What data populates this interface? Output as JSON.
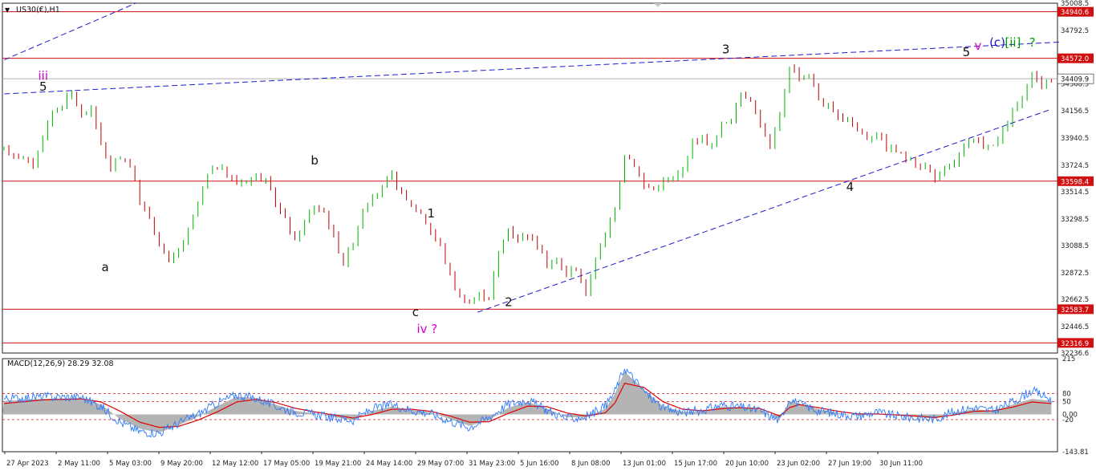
{
  "symbol_header": {
    "arrow": "▼",
    "label": "US30(€),H1"
  },
  "macd_header": "MACD(12,26,9) 28.29 32.08",
  "colors": {
    "bull": "#00b400",
    "bear": "#c00000",
    "hline": "#d01010",
    "trend": "#1c1ccc",
    "label_black": "#111111",
    "label_magenta": "#d400d4",
    "label_blue": "#1c1ccc",
    "label_green": "#00a000",
    "hist": "#b4b4b4",
    "signal": "#e00000",
    "macd_line": "#2a7aff",
    "price_line": "#b0b0b0",
    "axis_text": "#222222"
  },
  "chart_data": [
    {
      "type": "candlestick",
      "title": "US30(€),H1",
      "ylim": [
        32236.6,
        35008.5
      ],
      "y_tick_labels": [
        "35008.5",
        "34792.5",
        "34570.5",
        "34368.5",
        "34156.5",
        "33940.5",
        "33724.5",
        "33514.5",
        "33298.5",
        "33088.5",
        "32872.5",
        "32662.5",
        "32446.5",
        "32236.6"
      ],
      "x_tick_labels": [
        "27 Apr 2023",
        "2 May 11:00",
        "5 May 03:00",
        "9 May 20:00",
        "12 May 12:00",
        "17 May 05:00",
        "19 May 21:00",
        "24 May 14:00",
        "29 May 07:00",
        "31 May 23:00",
        "5 Jun 16:00",
        "8 Jun 08:00",
        "13 Jun 01:00",
        "15 Jun 17:00",
        "20 Jun 10:00",
        "23 Jun 02:00",
        "27 Jun 19:00",
        "30 Jun 11:00"
      ],
      "horizontal_levels": [
        {
          "value": 34940.6,
          "label": "34940.6"
        },
        {
          "value": 34572.0,
          "label": "34572.0"
        },
        {
          "value": 33598.4,
          "label": "33598.4"
        },
        {
          "value": 32583.7,
          "label": "32583.7"
        },
        {
          "value": 32316.9,
          "label": "32316.9"
        }
      ],
      "current_price": {
        "value": 34409.9,
        "label": "34409.9"
      },
      "price_path": [
        [
          0,
          33850
        ],
        [
          2,
          33780
        ],
        [
          3,
          33720
        ],
        [
          4,
          33950
        ],
        [
          5,
          34150
        ],
        [
          6,
          34210
        ],
        [
          7,
          34300
        ],
        [
          8,
          34120
        ],
        [
          9,
          34170
        ],
        [
          10,
          33900
        ],
        [
          11,
          33690
        ],
        [
          12,
          33800
        ],
        [
          13,
          33720
        ],
        [
          14,
          33440
        ],
        [
          15,
          33300
        ],
        [
          16,
          33110
        ],
        [
          17,
          32950
        ],
        [
          18,
          33050
        ],
        [
          19,
          33200
        ],
        [
          20,
          33420
        ],
        [
          21,
          33650
        ],
        [
          22,
          33720
        ],
        [
          23,
          33650
        ],
        [
          24,
          33580
        ],
        [
          25,
          33610
        ],
        [
          26,
          33640
        ],
        [
          27,
          33600
        ],
        [
          28,
          33420
        ],
        [
          29,
          33300
        ],
        [
          30,
          33120
        ],
        [
          31,
          33280
        ],
        [
          32,
          33400
        ],
        [
          33,
          33360
        ],
        [
          34,
          33160
        ],
        [
          35,
          32950
        ],
        [
          36,
          33120
        ],
        [
          37,
          33380
        ],
        [
          38,
          33460
        ],
        [
          39,
          33550
        ],
        [
          40,
          33640
        ],
        [
          41,
          33480
        ],
        [
          42,
          33410
        ],
        [
          43,
          33350
        ],
        [
          44,
          33200
        ],
        [
          45,
          33080
        ],
        [
          46,
          32850
        ],
        [
          47,
          32680
        ],
        [
          48,
          32640
        ],
        [
          49,
          32700
        ],
        [
          50,
          32680
        ],
        [
          51,
          33030
        ],
        [
          52,
          33220
        ],
        [
          53,
          33150
        ],
        [
          54,
          33180
        ],
        [
          55,
          33100
        ],
        [
          56,
          32940
        ],
        [
          57,
          32960
        ],
        [
          58,
          32870
        ],
        [
          59,
          32910
        ],
        [
          60,
          32700
        ],
        [
          61,
          33000
        ],
        [
          62,
          33160
        ],
        [
          63,
          33400
        ],
        [
          64,
          33820
        ],
        [
          65,
          33730
        ],
        [
          66,
          33560
        ],
        [
          67,
          33540
        ],
        [
          68,
          33600
        ],
        [
          69,
          33620
        ],
        [
          70,
          33680
        ],
        [
          71,
          33920
        ],
        [
          72,
          33940
        ],
        [
          73,
          33870
        ],
        [
          74,
          34040
        ],
        [
          75,
          34100
        ],
        [
          76,
          34290
        ],
        [
          77,
          34250
        ],
        [
          78,
          34050
        ],
        [
          79,
          33870
        ],
        [
          80,
          34110
        ],
        [
          81,
          34520
        ],
        [
          82,
          34420
        ],
        [
          83,
          34440
        ],
        [
          84,
          34250
        ],
        [
          85,
          34180
        ],
        [
          86,
          34090
        ],
        [
          87,
          34110
        ],
        [
          88,
          34010
        ],
        [
          89,
          33940
        ],
        [
          90,
          33990
        ],
        [
          91,
          33870
        ],
        [
          92,
          33840
        ],
        [
          93,
          33780
        ],
        [
          94,
          33740
        ],
        [
          95,
          33720
        ],
        [
          96,
          33620
        ],
        [
          97,
          33680
        ],
        [
          98,
          33750
        ],
        [
          99,
          33870
        ],
        [
          100,
          33920
        ],
        [
          101,
          33890
        ],
        [
          102,
          33870
        ],
        [
          103,
          33980
        ],
        [
          104,
          34150
        ],
        [
          105,
          34250
        ],
        [
          106,
          34440
        ],
        [
          107,
          34360
        ],
        [
          108,
          34410
        ]
      ],
      "wave_labels": [
        {
          "text": "iii",
          "color": "magenta",
          "x": 10,
          "y": 34400
        },
        {
          "text": "5",
          "color": "black",
          "x": 10,
          "y": 34315
        },
        {
          "text": "a",
          "color": "black",
          "x": 26,
          "y": 32885
        },
        {
          "text": "b",
          "color": "black",
          "x": 80,
          "y": 33730
        },
        {
          "text": "c",
          "color": "black",
          "x": 106,
          "y": 32530
        },
        {
          "text": "iv ?",
          "color": "magenta",
          "x": 109,
          "y": 32395
        },
        {
          "text": "1",
          "color": "black",
          "x": 110,
          "y": 33310
        },
        {
          "text": "2",
          "color": "black",
          "x": 130,
          "y": 32610
        },
        {
          "text": "3",
          "color": "black",
          "x": 186,
          "y": 34610
        },
        {
          "text": "4",
          "color": "black",
          "x": 218,
          "y": 33520
        },
        {
          "text": "5",
          "color": "black",
          "x": 248,
          "y": 34590
        },
        {
          "text": "v",
          "color": "magenta",
          "x": 251,
          "y": 34640
        },
        {
          "text": "(c)",
          "color": "blue",
          "x": 256,
          "y": 34665
        },
        {
          "text": "[ii]",
          "color": "green",
          "x": 260,
          "y": 34665
        },
        {
          "text": "?",
          "color": "green",
          "x": 265,
          "y": 34665
        }
      ],
      "trendlines": [
        {
          "name": "upper-channel",
          "p1": [
            0,
            34290
          ],
          "p2": [
            272,
            34700
          ]
        },
        {
          "name": "lower-channel",
          "p1": [
            122,
            32560
          ],
          "p2": [
            270,
            34170
          ]
        },
        {
          "name": "top-left-line",
          "p1": [
            0,
            34560
          ],
          "p2": [
            34,
            35010
          ]
        }
      ]
    },
    {
      "type": "macd",
      "title": "MACD(12,26,9) 28.29 32.08",
      "indicator": "MACD(12,26,9)",
      "ylim": [
        -143.81,
        215
      ],
      "y_tick_labels": [
        "215",
        "80",
        "50",
        "0.00",
        "-20",
        "-143.81"
      ],
      "dashed_levels": [
        80,
        50,
        -20
      ],
      "histogram": [
        [
          0,
          52
        ],
        [
          4,
          60
        ],
        [
          8,
          62
        ],
        [
          10,
          38
        ],
        [
          12,
          -18
        ],
        [
          14,
          -55
        ],
        [
          16,
          -70
        ],
        [
          18,
          -42
        ],
        [
          20,
          -8
        ],
        [
          22,
          32
        ],
        [
          24,
          68
        ],
        [
          26,
          64
        ],
        [
          28,
          38
        ],
        [
          30,
          14
        ],
        [
          32,
          4
        ],
        [
          34,
          -10
        ],
        [
          36,
          -22
        ],
        [
          38,
          14
        ],
        [
          40,
          30
        ],
        [
          42,
          18
        ],
        [
          44,
          8
        ],
        [
          46,
          -18
        ],
        [
          48,
          -44
        ],
        [
          50,
          -22
        ],
        [
          52,
          26
        ],
        [
          54,
          48
        ],
        [
          56,
          22
        ],
        [
          58,
          -10
        ],
        [
          60,
          -12
        ],
        [
          62,
          22
        ],
        [
          63,
          80
        ],
        [
          64,
          165
        ],
        [
          66,
          95
        ],
        [
          68,
          30
        ],
        [
          70,
          10
        ],
        [
          72,
          12
        ],
        [
          74,
          30
        ],
        [
          76,
          28
        ],
        [
          78,
          18
        ],
        [
          80,
          -18
        ],
        [
          81,
          50
        ],
        [
          82,
          42
        ],
        [
          84,
          20
        ],
        [
          86,
          6
        ],
        [
          88,
          -4
        ],
        [
          90,
          4
        ],
        [
          92,
          -4
        ],
        [
          94,
          -10
        ],
        [
          96,
          -16
        ],
        [
          98,
          6
        ],
        [
          100,
          20
        ],
        [
          102,
          14
        ],
        [
          104,
          38
        ],
        [
          106,
          60
        ],
        [
          108,
          52
        ]
      ],
      "signal": [
        [
          0,
          42
        ],
        [
          4,
          56
        ],
        [
          8,
          60
        ],
        [
          10,
          48
        ],
        [
          12,
          12
        ],
        [
          14,
          -30
        ],
        [
          16,
          -50
        ],
        [
          18,
          -46
        ],
        [
          20,
          -22
        ],
        [
          22,
          10
        ],
        [
          24,
          48
        ],
        [
          26,
          58
        ],
        [
          28,
          46
        ],
        [
          30,
          24
        ],
        [
          32,
          10
        ],
        [
          34,
          -2
        ],
        [
          36,
          -14
        ],
        [
          38,
          0
        ],
        [
          40,
          20
        ],
        [
          42,
          20
        ],
        [
          44,
          12
        ],
        [
          46,
          -6
        ],
        [
          48,
          -30
        ],
        [
          50,
          -28
        ],
        [
          52,
          4
        ],
        [
          54,
          32
        ],
        [
          56,
          30
        ],
        [
          58,
          6
        ],
        [
          60,
          -6
        ],
        [
          62,
          6
        ],
        [
          63,
          44
        ],
        [
          64,
          120
        ],
        [
          66,
          104
        ],
        [
          68,
          48
        ],
        [
          70,
          20
        ],
        [
          72,
          14
        ],
        [
          74,
          22
        ],
        [
          76,
          26
        ],
        [
          78,
          22
        ],
        [
          80,
          -6
        ],
        [
          81,
          26
        ],
        [
          82,
          38
        ],
        [
          84,
          26
        ],
        [
          86,
          12
        ],
        [
          88,
          2
        ],
        [
          90,
          2
        ],
        [
          92,
          -2
        ],
        [
          94,
          -6
        ],
        [
          96,
          -12
        ],
        [
          98,
          -2
        ],
        [
          100,
          12
        ],
        [
          102,
          14
        ],
        [
          104,
          28
        ],
        [
          106,
          48
        ],
        [
          108,
          42
        ]
      ],
      "macd_line": [
        [
          0,
          60
        ],
        [
          4,
          68
        ],
        [
          8,
          66
        ],
        [
          10,
          30
        ],
        [
          12,
          -30
        ],
        [
          14,
          -66
        ],
        [
          16,
          -72
        ],
        [
          18,
          -34
        ],
        [
          20,
          0
        ],
        [
          22,
          44
        ],
        [
          24,
          76
        ],
        [
          26,
          62
        ],
        [
          28,
          32
        ],
        [
          30,
          10
        ],
        [
          32,
          0
        ],
        [
          34,
          -14
        ],
        [
          36,
          -22
        ],
        [
          38,
          22
        ],
        [
          40,
          38
        ],
        [
          42,
          16
        ],
        [
          44,
          4
        ],
        [
          46,
          -26
        ],
        [
          48,
          -50
        ],
        [
          50,
          -12
        ],
        [
          52,
          40
        ],
        [
          54,
          56
        ],
        [
          56,
          16
        ],
        [
          58,
          -16
        ],
        [
          60,
          -10
        ],
        [
          62,
          32
        ],
        [
          63,
          90
        ],
        [
          64,
          180
        ],
        [
          66,
          88
        ],
        [
          68,
          22
        ],
        [
          70,
          8
        ],
        [
          72,
          16
        ],
        [
          74,
          36
        ],
        [
          76,
          28
        ],
        [
          78,
          14
        ],
        [
          80,
          -24
        ],
        [
          81,
          62
        ],
        [
          82,
          40
        ],
        [
          84,
          14
        ],
        [
          86,
          2
        ],
        [
          88,
          -6
        ],
        [
          90,
          8
        ],
        [
          92,
          -6
        ],
        [
          94,
          -14
        ],
        [
          96,
          -18
        ],
        [
          98,
          12
        ],
        [
          100,
          26
        ],
        [
          102,
          14
        ],
        [
          104,
          48
        ],
        [
          106,
          92
        ],
        [
          108,
          58
        ]
      ]
    }
  ]
}
